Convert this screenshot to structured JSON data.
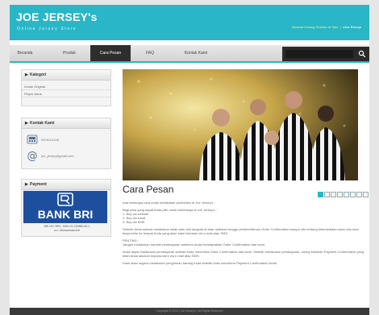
{
  "header": {
    "title": "JOE JERSEY's",
    "subtitle": "Online Jersey Store",
    "welcome_text": "Selamat Datang Gelaran di Toko",
    "welcome_link": "Lihat Belanja"
  },
  "nav": {
    "items": [
      "Beranda",
      "Produk",
      "Cara Pesan",
      "FAQ",
      "Kontak Kami"
    ],
    "active": "Cara Pesan"
  },
  "search": {
    "placeholder": "",
    "icon": "search-icon"
  },
  "sidebar": {
    "kategori": {
      "title": "Kategori",
      "items": [
        "Grade Original",
        "Player Issue"
      ]
    },
    "kontak": {
      "title": "Kontak Kami",
      "phone": "0878101106",
      "email": "joe_jersey@gmail.com",
      "phone_icon": "phone-icon",
      "email_icon": "at-icon"
    },
    "payment": {
      "title": "Payment",
      "bank_name": "BANK BRI",
      "caption_line1": "BRI NO. REK. 3020-01-015883-50-2",
      "caption_line2": "a.n. Muhammad Arif"
    }
  },
  "main": {
    "title": "Cara Pesan",
    "pager_count": 8,
    "pager_active": 1,
    "paragraphs": [
      "Ada beberapa cara untuk melakukan pembelian di Joe Jersey's :",
      "Bagi para yang dapat Anda pilih untuk berbelanja di Joe Jersey's :",
      "1. Buy via website",
      "2. Buy via email",
      "3. Buy via SMS",
      "Setelah Anda selesai melakukan salah satu dari langkah di atas, silahkan tunggu pemberitahuan Order Confirmation barupa info tentang ketersediaan stock dan total biaya kirim ke tempat Anda yang akan kami kirimkan via e-mail atau SMS.",
      "PENTING :",
      "Jangan melakukan transfer pembayaran sebelum Anda mendapatkan Order Confirmation dari kami.",
      "Anda dapat melakukan pembayaran setelah Anda menerima Order Confirmation dari kami. Setelah melakukan pembayaran, tolong kirimkan Payment Confirmation yang telah Anda lakukan kepada kami via e-mail atau SMS.",
      "Kami akan segera melakukan pengiriman barang Anda setelah kami menerima Payment Confirmation Anda."
    ]
  },
  "footer": {
    "text": "Copyright © 2012 | Joe Jersey's | All Rights Reserved"
  },
  "colors": {
    "accent": "#29b6c6",
    "nav_active": "#2e2e2e",
    "bank_blue": "#1e4f9e",
    "welcome": "#f3f58a"
  }
}
